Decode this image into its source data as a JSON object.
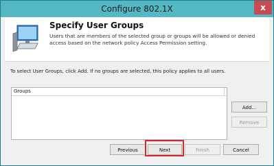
{
  "window": {
    "title": "Configure 802.1X",
    "close_label": "x"
  },
  "header": {
    "icon": "computer-icon",
    "heading": "Specify User Groups",
    "description": "Users that are members of the selected group or groups will be allowed or denied access based on the network policy Access Permission setting."
  },
  "body": {
    "info": "To select User Groups, click Add. If no groups are selected, this policy applies to all users.",
    "list": {
      "column_groups": "Groups",
      "rows": []
    },
    "add_label": "Add...",
    "remove_label": "Remove"
  },
  "footer": {
    "previous_label": "Previous",
    "next_label": "Next",
    "finish_label": "Finish",
    "cancel_label": "Cancel"
  },
  "colors": {
    "titlebar": "#54b8c4",
    "close": "#c74b50",
    "highlight": "#d9262b"
  }
}
